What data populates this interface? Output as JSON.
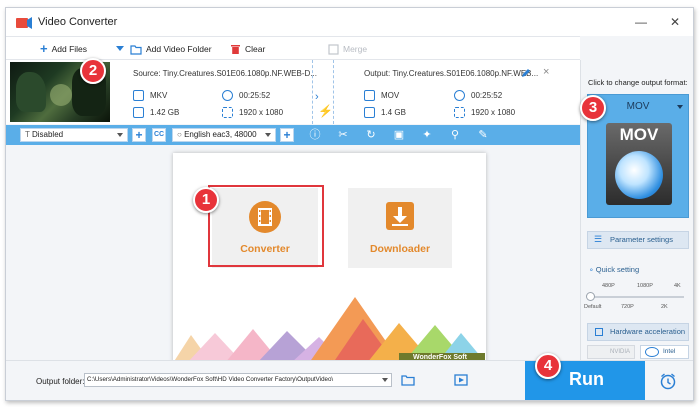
{
  "window": {
    "title": "Video Converter"
  },
  "toolbar": {
    "add_files": "Add Files",
    "add_video_folder": "Add Video Folder",
    "clear": "Clear",
    "merge": "Merge"
  },
  "source": {
    "label": "Source: Tiny.Creatures.S01E06.1080p.NF.WEB-D...",
    "format": "MKV",
    "duration": "00:25:52",
    "size": "1.42 GB",
    "resolution": "1920 x 1080"
  },
  "output": {
    "label": "Output: Tiny.Creatures.S01E06.1080p.NF.WEB...",
    "format": "MOV",
    "duration": "00:25:52",
    "size": "1.4 GB",
    "resolution": "1920 x 1080"
  },
  "subtitle_select": {
    "value": "Disabled"
  },
  "audio_select": {
    "value": "English eac3, 48000"
  },
  "cc_label": "CC",
  "home": {
    "converter": "Converter",
    "downloader": "Downloader",
    "brand": "WonderFox Soft"
  },
  "right_panel": {
    "hint": "Click to change output format:",
    "format": "MOV",
    "format_icon_text": "MOV",
    "parameter_settings": "Parameter settings",
    "quick_setting": "Quick setting",
    "slider_top_labels": [
      "480P",
      "1080P",
      "4K"
    ],
    "slider_bottom_labels": [
      "Default",
      "720P",
      "2K"
    ],
    "slider_position": 0,
    "hardware_acceleration": "Hardware acceleration",
    "nvidia": "NVIDIA",
    "intel": "Intel"
  },
  "bottom": {
    "output_folder_label": "Output folder:",
    "output_folder_value": "C:\\Users\\Administrator\\Videos\\WonderFox Soft\\HD Video Converter Factory\\OutputVideo\\",
    "run": "Run"
  },
  "markers": [
    "1",
    "2",
    "3",
    "4"
  ],
  "colors": {
    "accent_blue": "#2a7fd4",
    "bar_blue": "#5aaee8",
    "run_blue": "#2196e8",
    "orange": "#e3892c",
    "marker_red": "#e8333a",
    "highlight_red": "#e0363c"
  }
}
